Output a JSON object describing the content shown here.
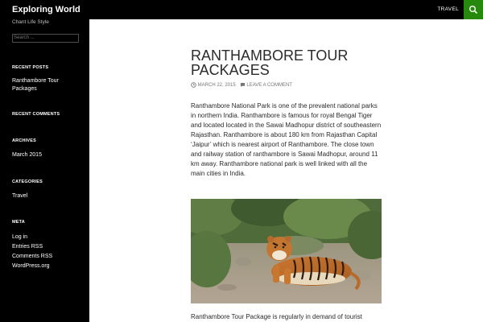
{
  "header": {
    "site_title": "Exploring World",
    "menu_item": "TRAVEL",
    "accent": "#24890d"
  },
  "sidebar": {
    "tagline": "Chant Life Style",
    "search_placeholder": "Search ...",
    "recent_posts": {
      "title": "RECENT POSTS",
      "items": [
        "Ranthambore Tour Packages"
      ]
    },
    "recent_comments": {
      "title": "RECENT COMMENTS"
    },
    "archives": {
      "title": "ARCHIVES",
      "items": [
        "March 2015"
      ]
    },
    "categories": {
      "title": "CATEGORIES",
      "items": [
        "Travel"
      ]
    },
    "meta": {
      "title": "META",
      "items": [
        "Log in",
        "Entries RSS",
        "Comments RSS",
        "WordPress.org"
      ]
    }
  },
  "post": {
    "title": "RANTHAMBORE TOUR PACKAGES",
    "date": "MARCH 22, 2015",
    "comment_link": "LEAVE A COMMENT",
    "body": "Ranthambore National Park is one of the prevalent national parks in northern India. Ranthambore is famous for royal Bengal Tiger and located located in the Sawai Madhopur district of southeastern Rajasthan. Ranthambore is about 180 km from Rajasthan Capital ‘Jaipur’ which is nearest airport of Ranthambore. The close town and railway station of ranthambore is Sawai Madhopur, around 11 km away. Ranthambore national park is well linked with all the main cities in India.",
    "body2": "Ranthambore Tour Package is regularly in demand of tourist"
  }
}
